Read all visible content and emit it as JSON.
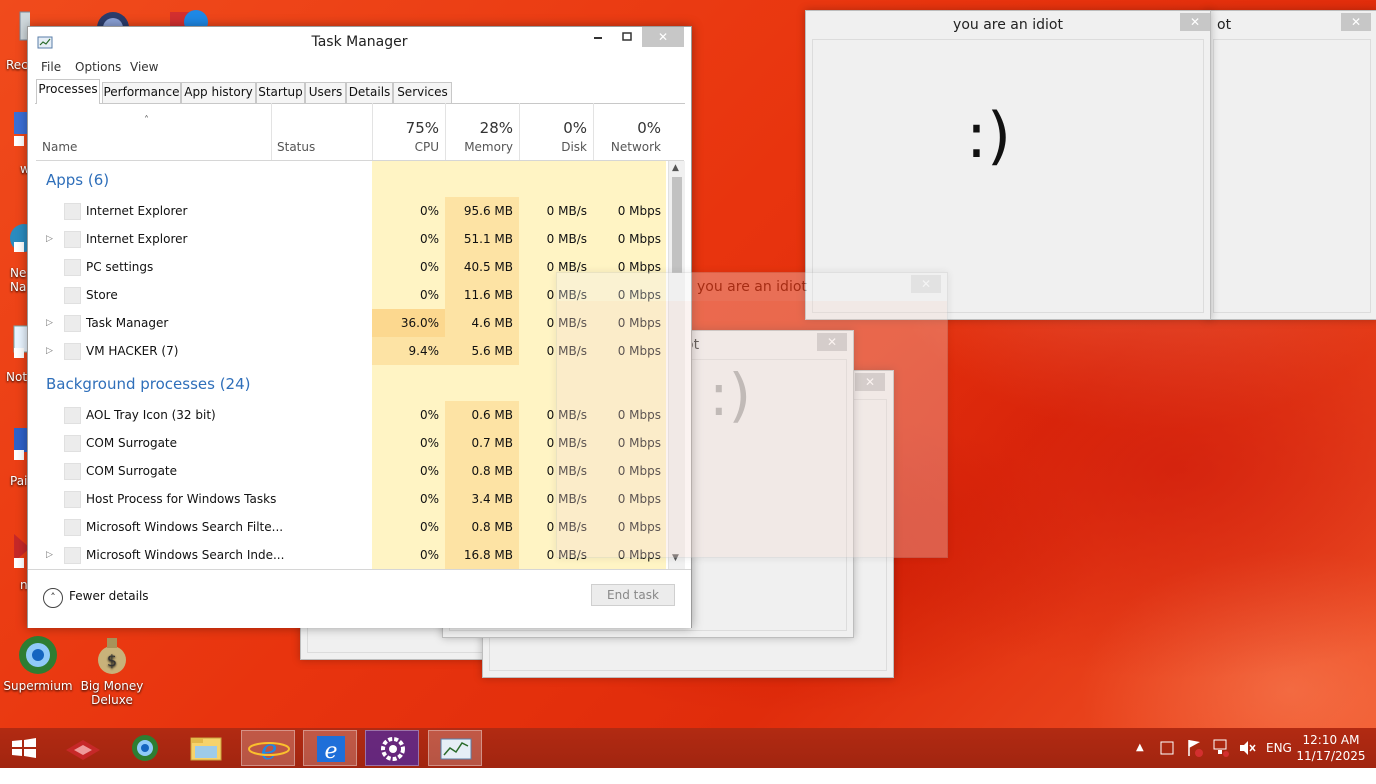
{
  "desktop": {
    "icons": [
      {
        "label": "Supermium"
      },
      {
        "label": "Big Money Deluxe"
      }
    ],
    "edge_labels": [
      "Rec",
      "w",
      "Ne Na",
      "Not",
      "Pai",
      "n"
    ]
  },
  "idiot_windows": {
    "main_title": "you are an idiot",
    "partial_title": "ot",
    "ghost_title": "you are an idiot",
    "partial_title_2": "ot",
    "smiley": ":)"
  },
  "task_manager": {
    "title": "Task Manager",
    "menu": [
      "File",
      "Options",
      "View"
    ],
    "tabs": [
      "Processes",
      "Performance",
      "App history",
      "Startup",
      "Users",
      "Details",
      "Services"
    ],
    "active_tab": "Processes",
    "columns": {
      "name": "Name",
      "status": "Status",
      "cpu": {
        "pct": "75%",
        "label": "CPU"
      },
      "memory": {
        "pct": "28%",
        "label": "Memory"
      },
      "disk": {
        "pct": "0%",
        "label": "Disk"
      },
      "network": {
        "pct": "0%",
        "label": "Network"
      }
    },
    "groups": {
      "apps": "Apps (6)",
      "background": "Background processes (24)"
    },
    "apps": [
      {
        "name": "Internet Explorer",
        "cpu": "0%",
        "mem": "95.6 MB",
        "disk": "0 MB/s",
        "net": "0 Mbps",
        "expand": false
      },
      {
        "name": "Internet Explorer",
        "cpu": "0%",
        "mem": "51.1 MB",
        "disk": "0 MB/s",
        "net": "0 Mbps",
        "expand": true
      },
      {
        "name": "PC settings",
        "cpu": "0%",
        "mem": "40.5 MB",
        "disk": "0 MB/s",
        "net": "0 Mbps",
        "expand": false
      },
      {
        "name": "Store",
        "cpu": "0%",
        "mem": "11.6 MB",
        "disk": "0 MB/s",
        "net": "0 Mbps",
        "expand": false
      },
      {
        "name": "Task Manager",
        "cpu": "36.0%",
        "mem": "4.6 MB",
        "disk": "0 MB/s",
        "net": "0 Mbps",
        "expand": true
      },
      {
        "name": "VM HACKER (7)",
        "cpu": "9.4%",
        "mem": "5.6 MB",
        "disk": "0 MB/s",
        "net": "0 Mbps",
        "expand": true
      }
    ],
    "background": [
      {
        "name": "AOL Tray Icon (32 bit)",
        "cpu": "0%",
        "mem": "0.6 MB",
        "disk": "0 MB/s",
        "net": "0 Mbps",
        "expand": false
      },
      {
        "name": "COM Surrogate",
        "cpu": "0%",
        "mem": "0.7 MB",
        "disk": "0 MB/s",
        "net": "0 Mbps",
        "expand": false
      },
      {
        "name": "COM Surrogate",
        "cpu": "0%",
        "mem": "0.8 MB",
        "disk": "0 MB/s",
        "net": "0 Mbps",
        "expand": false
      },
      {
        "name": "Host Process for Windows Tasks",
        "cpu": "0%",
        "mem": "3.4 MB",
        "disk": "0 MB/s",
        "net": "0 Mbps",
        "expand": false
      },
      {
        "name": "Microsoft Windows Search Filte...",
        "cpu": "0%",
        "mem": "0.8 MB",
        "disk": "0 MB/s",
        "net": "0 Mbps",
        "expand": false
      },
      {
        "name": "Microsoft Windows Search Inde...",
        "cpu": "0%",
        "mem": "16.8 MB",
        "disk": "0 MB/s",
        "net": "0 Mbps",
        "expand": true
      }
    ],
    "fewer_details": "Fewer details",
    "end_task": "End task"
  },
  "taskbar": {
    "language": "ENG",
    "time": "12:10 AM",
    "date": "11/17/2025"
  },
  "colors": {
    "cpu_high": "#fcd88f",
    "cpu_mid": "#fde3a4",
    "cpu_low": "#fff4c4",
    "group_text": "#2f6fba"
  }
}
